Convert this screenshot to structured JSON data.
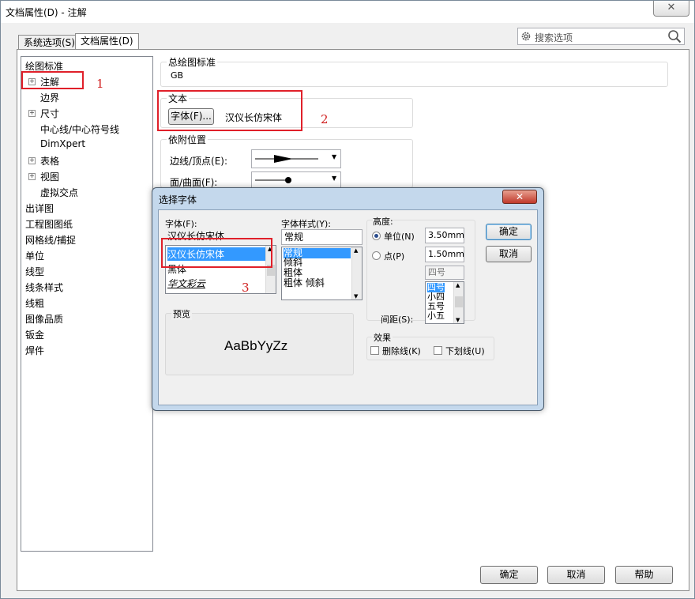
{
  "window": {
    "title": "文档属性(D) - 注解",
    "close_glyph": "✕"
  },
  "tabs": [
    {
      "label": "系统选项(S)"
    },
    {
      "label": "文档属性(D)"
    }
  ],
  "search": {
    "placeholder": "搜索选项"
  },
  "tree": {
    "items": [
      {
        "label": "绘图标准"
      },
      {
        "label": "注解"
      },
      {
        "label": "边界"
      },
      {
        "label": "尺寸"
      },
      {
        "label": "中心线/中心符号线"
      },
      {
        "label": "DimXpert"
      },
      {
        "label": "表格"
      },
      {
        "label": "视图"
      },
      {
        "label": "虚拟交点"
      },
      {
        "label": "出详图"
      },
      {
        "label": "工程图图纸"
      },
      {
        "label": "网格线/捕捉"
      },
      {
        "label": "单位"
      },
      {
        "label": "线型"
      },
      {
        "label": "线条样式"
      },
      {
        "label": "线粗"
      },
      {
        "label": "图像品质"
      },
      {
        "label": "钣金"
      },
      {
        "label": "焊件"
      }
    ]
  },
  "overall_standard": {
    "label": "总绘图标准",
    "value": "GB"
  },
  "text_group": {
    "label": "文本",
    "font_button": "字体(F)...",
    "font_name": "汉仪长仿宋体"
  },
  "attachment": {
    "label": "依附位置",
    "edge_label": "边线/顶点(E):",
    "face_label": "面/曲面(F):"
  },
  "annotations": [
    "1",
    "2",
    "3"
  ],
  "font_dialog": {
    "title": "选择字体",
    "font_label": "字体(F):",
    "font_value": "汉仪长仿宋体",
    "font_list": [
      "汉仪长仿宋体",
      "黑体",
      "华文彩云"
    ],
    "style_label": "字体样式(Y):",
    "style_value": "常规",
    "style_list": [
      "常规",
      "倾斜",
      "粗体",
      "粗体 倾斜"
    ],
    "height_label": "高度:",
    "unit_label": "单位(N)",
    "unit_value": "3.50mm",
    "point_label": "点(P)",
    "point_value": "1.50mm",
    "size_value": "四号",
    "size_list": [
      "四号",
      "小四",
      "五号",
      "小五"
    ],
    "spacing_label": "间距(S):",
    "ok": "确定",
    "cancel": "取消",
    "preview_label": "预览",
    "preview_text": "AaBbYyZz",
    "effects_label": "效果",
    "strikeout_label": "删除线(K)",
    "underline_label": "下划线(U)"
  },
  "footer": {
    "ok": "确定",
    "cancel": "取消",
    "help": "帮助"
  },
  "colors": {
    "highlight_red": "#e0202a",
    "selection_blue": "#3399ff",
    "dialog_frame": "#c4d8ec"
  }
}
